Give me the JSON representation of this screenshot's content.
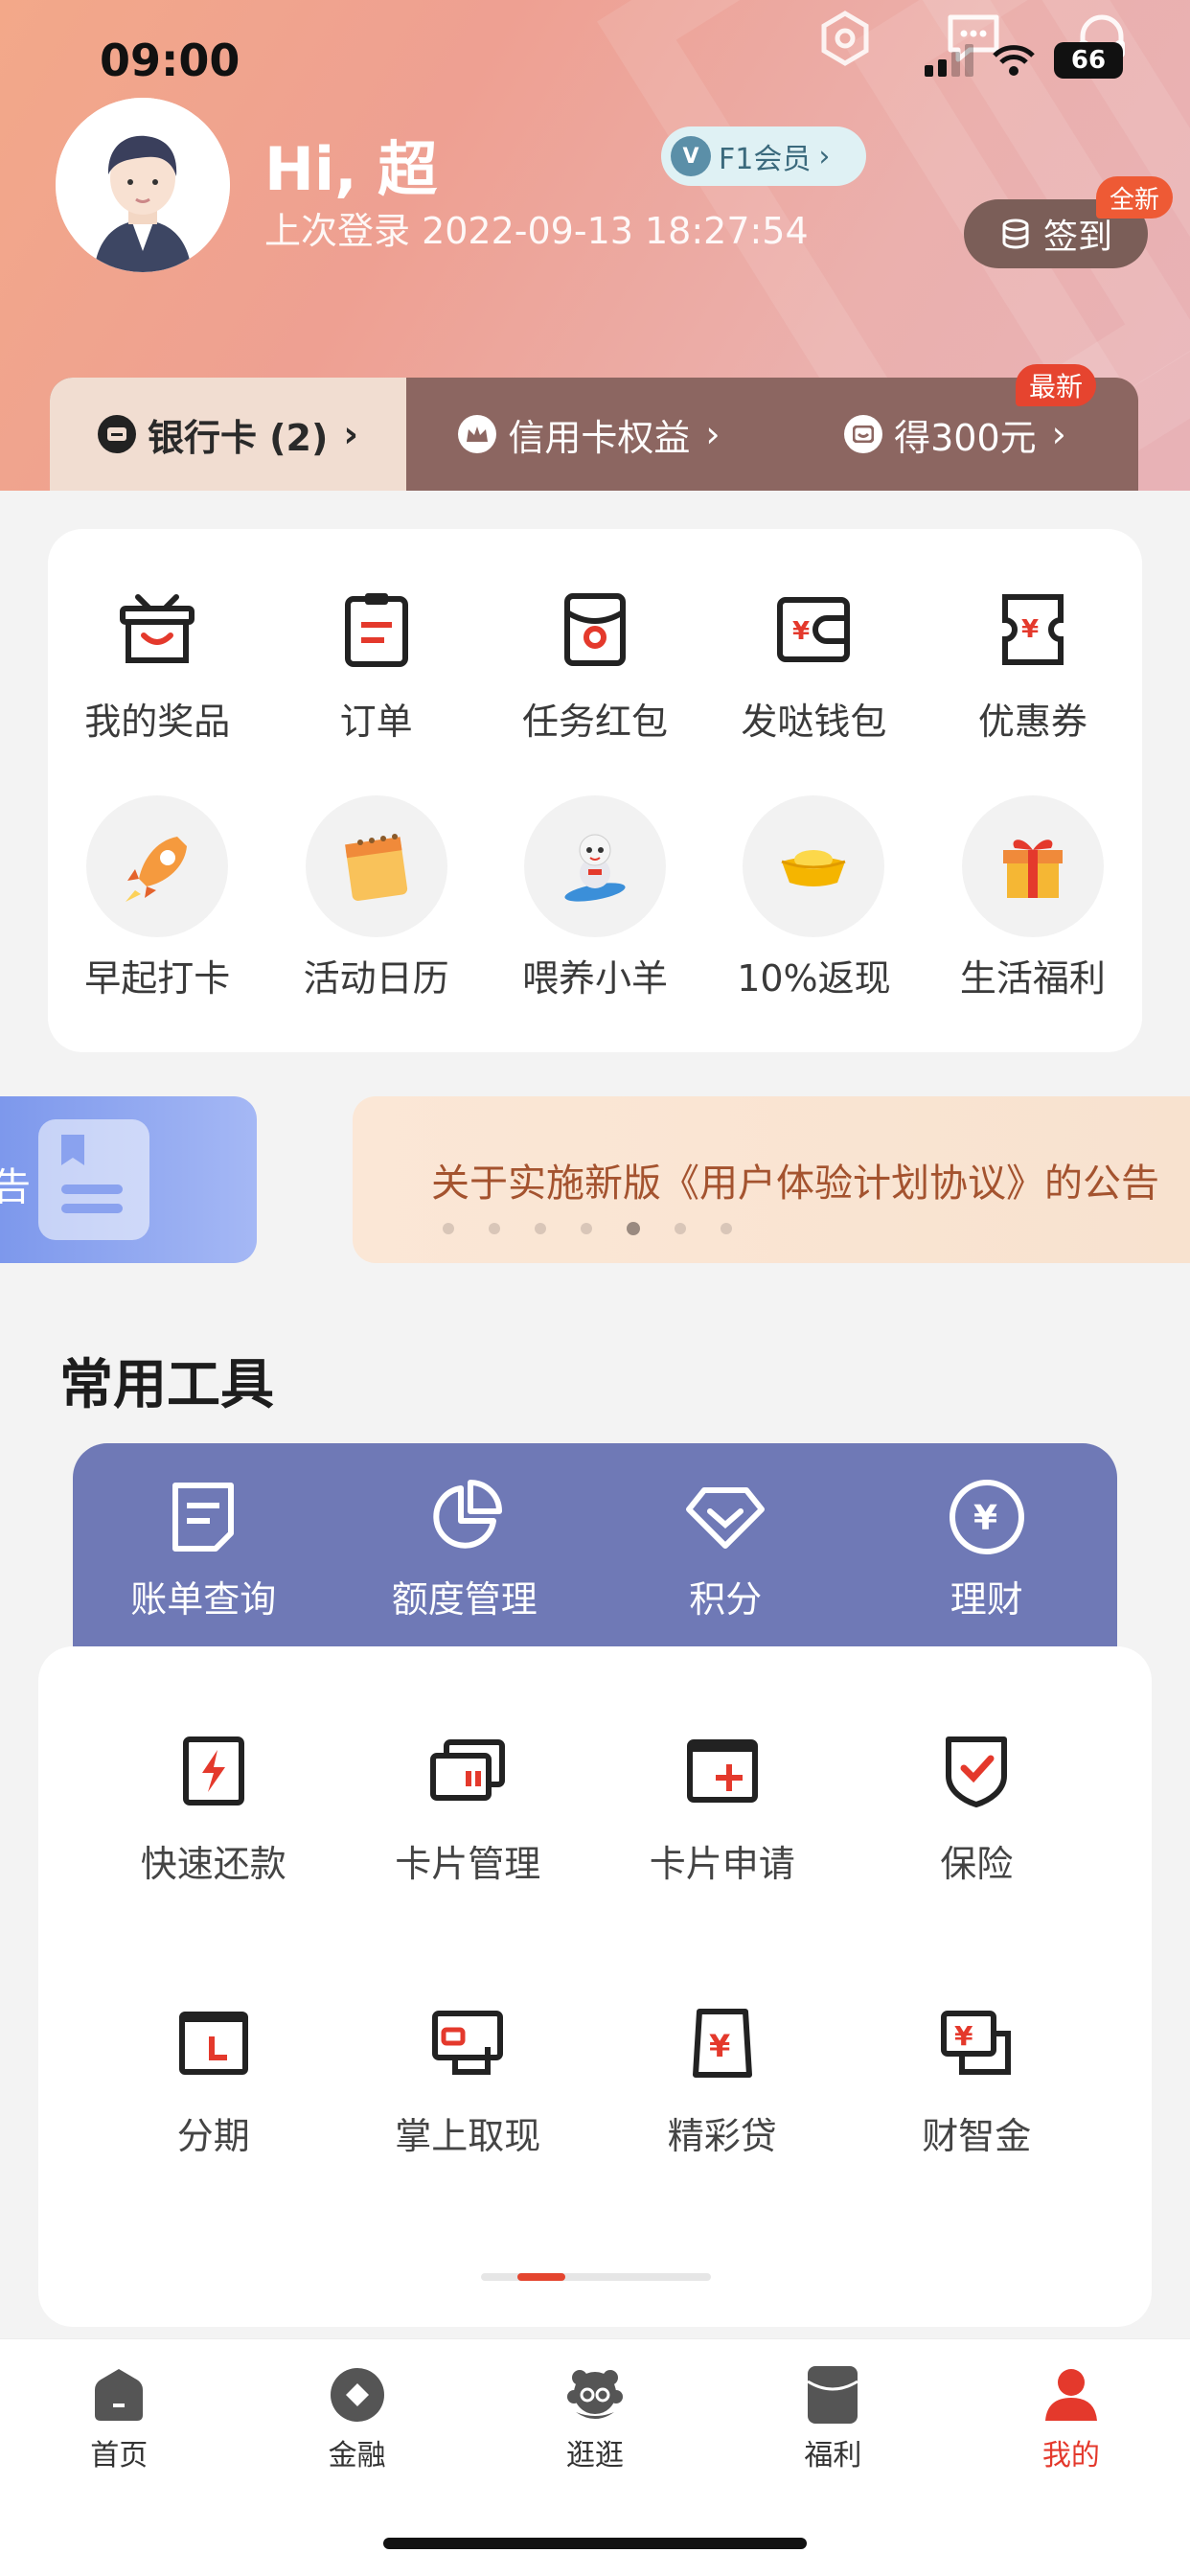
{
  "status_bar": {
    "time": "09:00",
    "battery": "66"
  },
  "profile": {
    "greeting": "Hi, 超",
    "last_login": "上次登录 2022-09-13 18:27:54",
    "member_badge": "F1会员",
    "checkin_label": "签到",
    "checkin_badge": "全新"
  },
  "card_tabs": [
    {
      "label": "银行卡 (2)",
      "active": true
    },
    {
      "label": "信用卡权益"
    },
    {
      "label": "得300元",
      "badge": "最新"
    }
  ],
  "quick_row1": [
    {
      "label": "我的奖品",
      "icon": "gift-basket-icon"
    },
    {
      "label": "订单",
      "icon": "clipboard-icon"
    },
    {
      "label": "任务红包",
      "icon": "red-envelope-icon"
    },
    {
      "label": "发哒钱包",
      "icon": "wallet-icon"
    },
    {
      "label": "优惠券",
      "icon": "coupon-icon"
    }
  ],
  "quick_row2": [
    {
      "label": "早起打卡",
      "icon": "rocket-icon"
    },
    {
      "label": "活动日历",
      "icon": "calendar-icon"
    },
    {
      "label": "喂养小羊",
      "icon": "sheep-icon"
    },
    {
      "label": "10%返现",
      "icon": "gold-ingot-icon"
    },
    {
      "label": "生活福利",
      "icon": "gift-box-icon"
    }
  ],
  "banner": {
    "left_partial": "告",
    "text": "关于实施新版《用户体验计划协议》的公告",
    "dot_count": 7,
    "active_dot": 4
  },
  "tools": {
    "title": "常用工具",
    "band": [
      {
        "label": "账单查询",
        "icon": "bill-icon"
      },
      {
        "label": "额度管理",
        "icon": "pie-chart-icon"
      },
      {
        "label": "积分",
        "icon": "diamond-icon"
      },
      {
        "label": "理财",
        "icon": "yen-circle-icon"
      }
    ],
    "row1": [
      {
        "label": "快速还款",
        "icon": "lightning-icon"
      },
      {
        "label": "卡片管理",
        "icon": "cards-icon"
      },
      {
        "label": "卡片申请",
        "icon": "card-add-icon"
      },
      {
        "label": "保险",
        "icon": "shield-check-icon"
      }
    ],
    "row2": [
      {
        "label": "分期",
        "icon": "installment-icon"
      },
      {
        "label": "掌上取现",
        "icon": "cash-icon"
      },
      {
        "label": "精彩贷",
        "icon": "loan-icon"
      },
      {
        "label": "财智金",
        "icon": "money-icon"
      }
    ],
    "scroll_position": 0.2
  },
  "tabbar": [
    {
      "label": "首页",
      "icon": "home-icon"
    },
    {
      "label": "金融",
      "icon": "finance-icon"
    },
    {
      "label": "逛逛",
      "icon": "browse-icon"
    },
    {
      "label": "福利",
      "icon": "welfare-icon"
    },
    {
      "label": "我的",
      "icon": "profile-icon",
      "active": true
    }
  ],
  "colors": {
    "accent": "#e4392c",
    "tool_band": "#6f79b6",
    "banner_text": "#a4532f"
  }
}
